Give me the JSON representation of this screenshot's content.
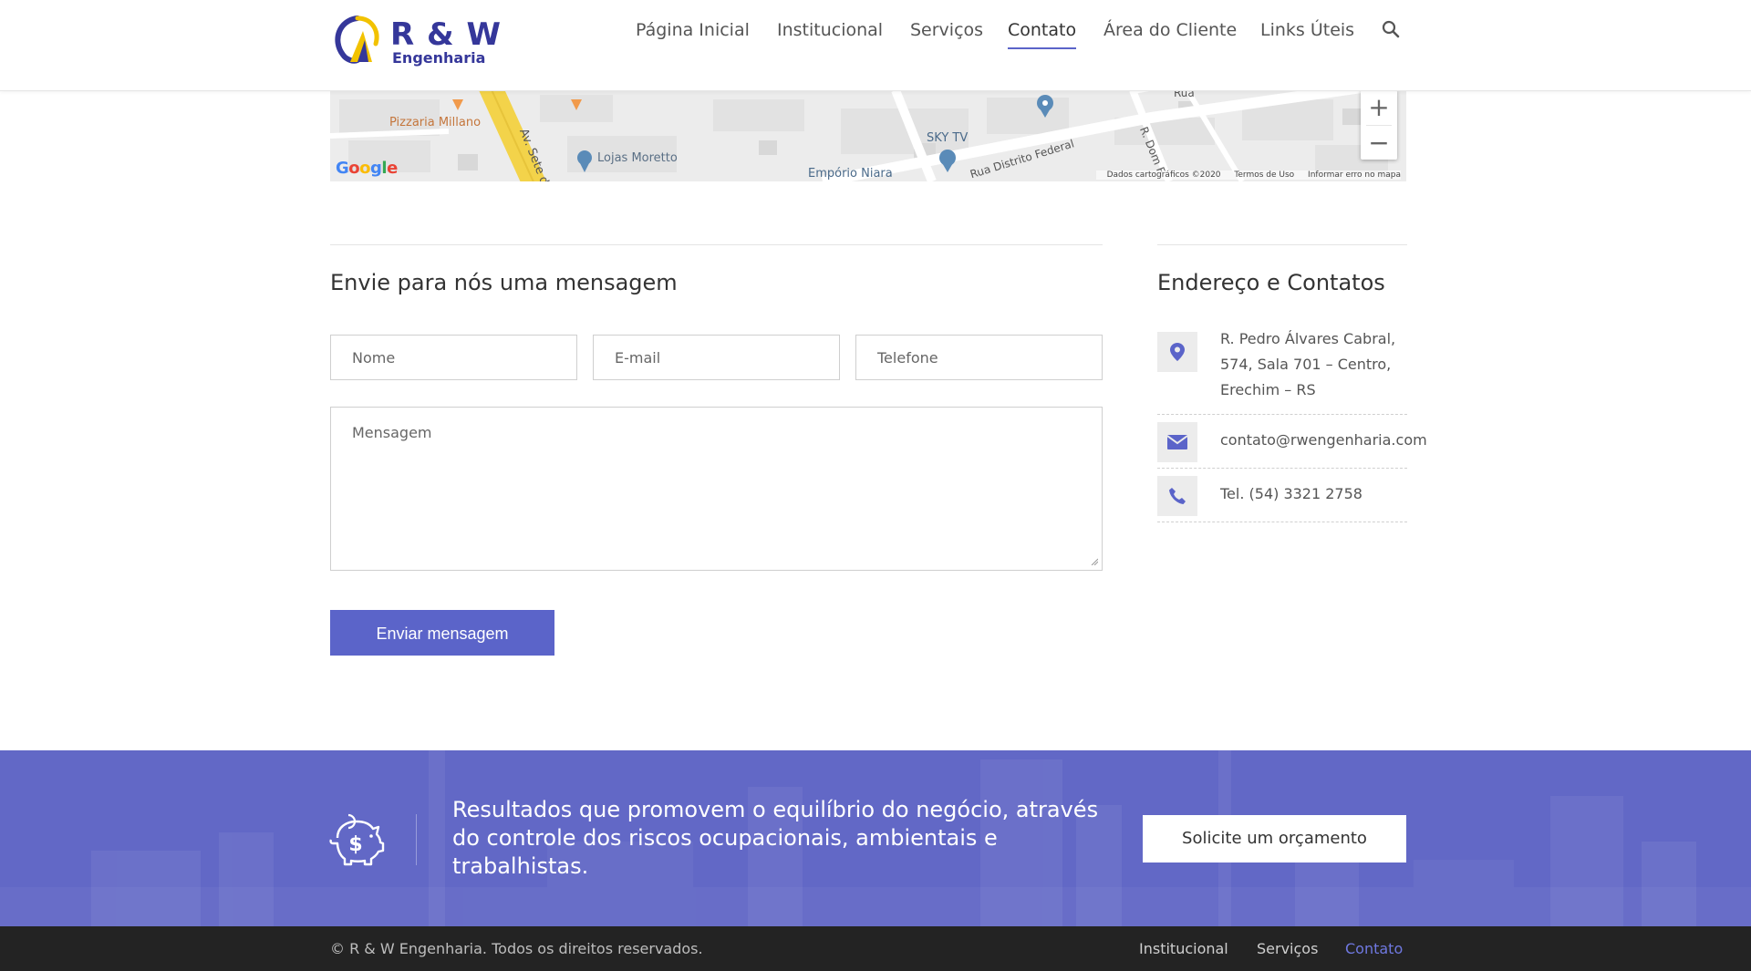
{
  "header": {
    "logo": {
      "brand": "R & W",
      "sub": "Engenharia"
    },
    "nav": [
      {
        "label": "Página Inicial"
      },
      {
        "label": "Institucional"
      },
      {
        "label": "Serviços"
      },
      {
        "label": "Contato",
        "active": true
      },
      {
        "label": "Área do Cliente"
      },
      {
        "label": "Links Úteis"
      }
    ],
    "search_icon": "search-icon"
  },
  "map": {
    "labels": {
      "pizzaria": "Pizzaria Millano",
      "avenue": "Av. Sete de",
      "lojas": "Lojas Moretto",
      "skytv": "SKY TV",
      "emporio": "Empório Niara",
      "rua_distrito": "Rua Distrito Federal",
      "rua_dom": "R. Dom F",
      "rua_top": "Rua"
    },
    "google": "Google",
    "zoom_in": "+",
    "zoom_out": "−",
    "footer": {
      "data": "Dados cartográficos ©2020",
      "terms": "Termos de Uso",
      "report": "Informar erro no mapa"
    }
  },
  "form": {
    "title": "Envie para nós uma mensagem",
    "name_placeholder": "Nome",
    "email_placeholder": "E-mail",
    "phone_placeholder": "Telefone",
    "message_placeholder": "Mensagem",
    "submit_label": "Enviar mensagem"
  },
  "contacts": {
    "title": "Endereço e Contatos",
    "address_lines": [
      "R. Pedro Álvares Cabral,",
      "574, Sala 701 – Centro,",
      "Erechim – RS"
    ],
    "email": "contato@rwengenharia.com",
    "phone": "Tel. (54) 3321 2758"
  },
  "cta": {
    "text": "Resultados que promovem o equilíbrio do negócio, através do controle dos riscos ocupacionais, ambientais e trabalhistas.",
    "button_label": "Solicite um orçamento",
    "icon": "piggy-bank-icon"
  },
  "footer": {
    "copyright": "© R & W Engenharia. Todos os direitos reservados.",
    "links": [
      {
        "label": "Institucional"
      },
      {
        "label": "Serviços"
      },
      {
        "label": "Contato",
        "active": true
      }
    ]
  },
  "colors": {
    "accent": "#5b64c9",
    "brand": "#35379a",
    "cta_bg": "#6268c6",
    "footer_bg": "#232323"
  }
}
